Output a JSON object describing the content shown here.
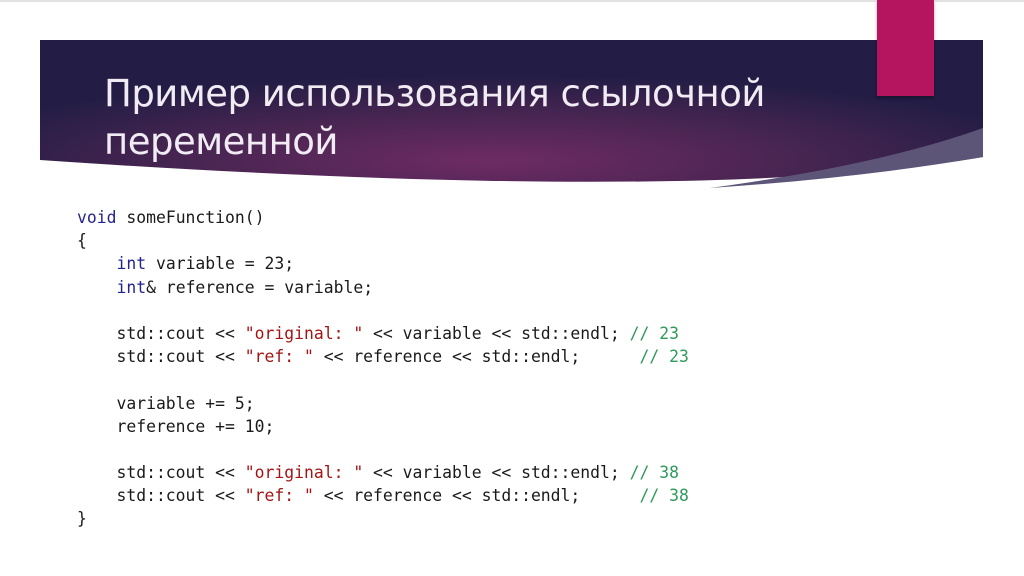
{
  "slide": {
    "title_lines": [
      "Пример использования ссылочной",
      "переменной"
    ],
    "colors": {
      "banner_dark": "#231d45",
      "banner_mid": "#6a2a62",
      "accent": "#b5145e",
      "swoosh": "#5d5577",
      "title_text": "#f1ecf4",
      "keyword": "#24248f",
      "string": "#a31515",
      "comment": "#2e9a5a",
      "code_text": "#1a1a1a"
    }
  },
  "code": {
    "language": "C++",
    "lines": [
      [
        {
          "t": "kw",
          "v": "void"
        },
        {
          "t": "plain",
          "v": " someFunction()"
        }
      ],
      [
        {
          "t": "plain",
          "v": "{"
        }
      ],
      [
        {
          "t": "plain",
          "v": "    "
        },
        {
          "t": "kw",
          "v": "int"
        },
        {
          "t": "plain",
          "v": " variable = 23;"
        }
      ],
      [
        {
          "t": "plain",
          "v": "    "
        },
        {
          "t": "kw",
          "v": "int"
        },
        {
          "t": "plain",
          "v": "& reference = variable;"
        }
      ],
      [],
      [
        {
          "t": "plain",
          "v": "    std::cout << "
        },
        {
          "t": "str",
          "v": "\"original: \""
        },
        {
          "t": "plain",
          "v": " << variable << std::endl; "
        },
        {
          "t": "cmt",
          "v": "// 23"
        }
      ],
      [
        {
          "t": "plain",
          "v": "    std::cout << "
        },
        {
          "t": "str",
          "v": "\"ref: \""
        },
        {
          "t": "plain",
          "v": " << reference << std::endl;      "
        },
        {
          "t": "cmt",
          "v": "// 23"
        }
      ],
      [],
      [
        {
          "t": "plain",
          "v": "    variable += 5;"
        }
      ],
      [
        {
          "t": "plain",
          "v": "    reference += 10;"
        }
      ],
      [],
      [
        {
          "t": "plain",
          "v": "    std::cout << "
        },
        {
          "t": "str",
          "v": "\"original: \""
        },
        {
          "t": "plain",
          "v": " << variable << std::endl; "
        },
        {
          "t": "cmt",
          "v": "// 38"
        }
      ],
      [
        {
          "t": "plain",
          "v": "    std::cout << "
        },
        {
          "t": "str",
          "v": "\"ref: \""
        },
        {
          "t": "plain",
          "v": " << reference << std::endl;      "
        },
        {
          "t": "cmt",
          "v": "// 38"
        }
      ],
      [
        {
          "t": "plain",
          "v": "}"
        }
      ]
    ]
  }
}
